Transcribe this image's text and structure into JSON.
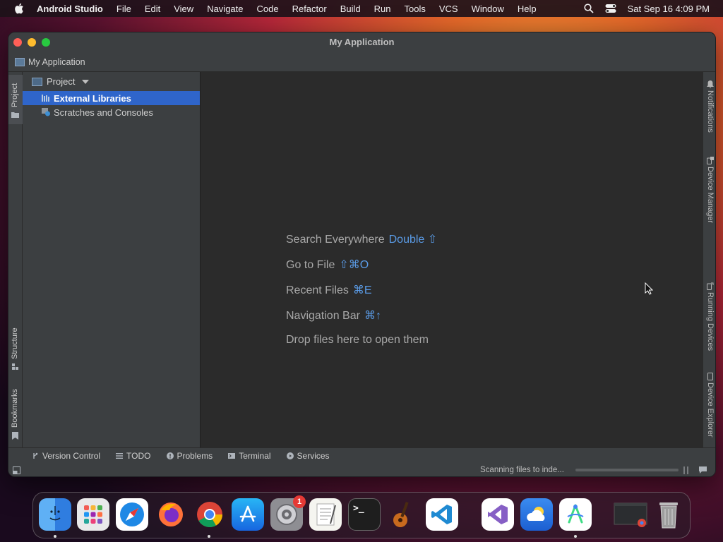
{
  "menubar": {
    "app_name": "Android Studio",
    "items": [
      "File",
      "Edit",
      "View",
      "Navigate",
      "Code",
      "Refactor",
      "Build",
      "Run",
      "Tools",
      "VCS",
      "Window",
      "Help"
    ],
    "clock": "Sat Sep 16  4:09 PM"
  },
  "window": {
    "title": "My Application",
    "breadcrumb": "My Application"
  },
  "left_stripe": {
    "project": "Project",
    "structure": "Structure",
    "bookmarks": "Bookmarks"
  },
  "project_panel": {
    "header": "Project",
    "items": [
      {
        "label": "External Libraries",
        "selected": true
      },
      {
        "label": "Scratches and Consoles",
        "selected": false
      }
    ]
  },
  "editor": {
    "hints": [
      {
        "label": "Search Everywhere",
        "shortcut": "Double ⇧"
      },
      {
        "label": "Go to File",
        "shortcut": "⇧⌘O"
      },
      {
        "label": "Recent Files",
        "shortcut": "⌘E"
      },
      {
        "label": "Navigation Bar",
        "shortcut": "⌘↑"
      }
    ],
    "drop_text": "Drop files here to open them"
  },
  "right_stripe": {
    "notifications": "Notifications",
    "device_manager": "Device Manager",
    "running_devices": "Running Devices",
    "device_explorer": "Device Explorer"
  },
  "bottom_toolbar": {
    "version_control": "Version Control",
    "todo": "TODO",
    "problems": "Problems",
    "terminal": "Terminal",
    "services": "Services"
  },
  "status_bar": {
    "status": "Scanning files to inde..."
  },
  "dock": {
    "settings_badge": "1",
    "terminal_prompt": ">_",
    "apps": [
      "Finder",
      "Launchpad",
      "Safari",
      "Firefox",
      "Chrome",
      "App Store",
      "System Settings",
      "TextEdit",
      "Terminal",
      "GarageBand",
      "VS Code",
      "Visual Studio",
      "Weather",
      "Android Studio",
      "Recent Window",
      "Trash"
    ]
  },
  "colors": {
    "selection": "#2f65ca",
    "shortcut": "#5a9be6",
    "panel": "#3c3f41",
    "editor": "#2b2b2b"
  }
}
